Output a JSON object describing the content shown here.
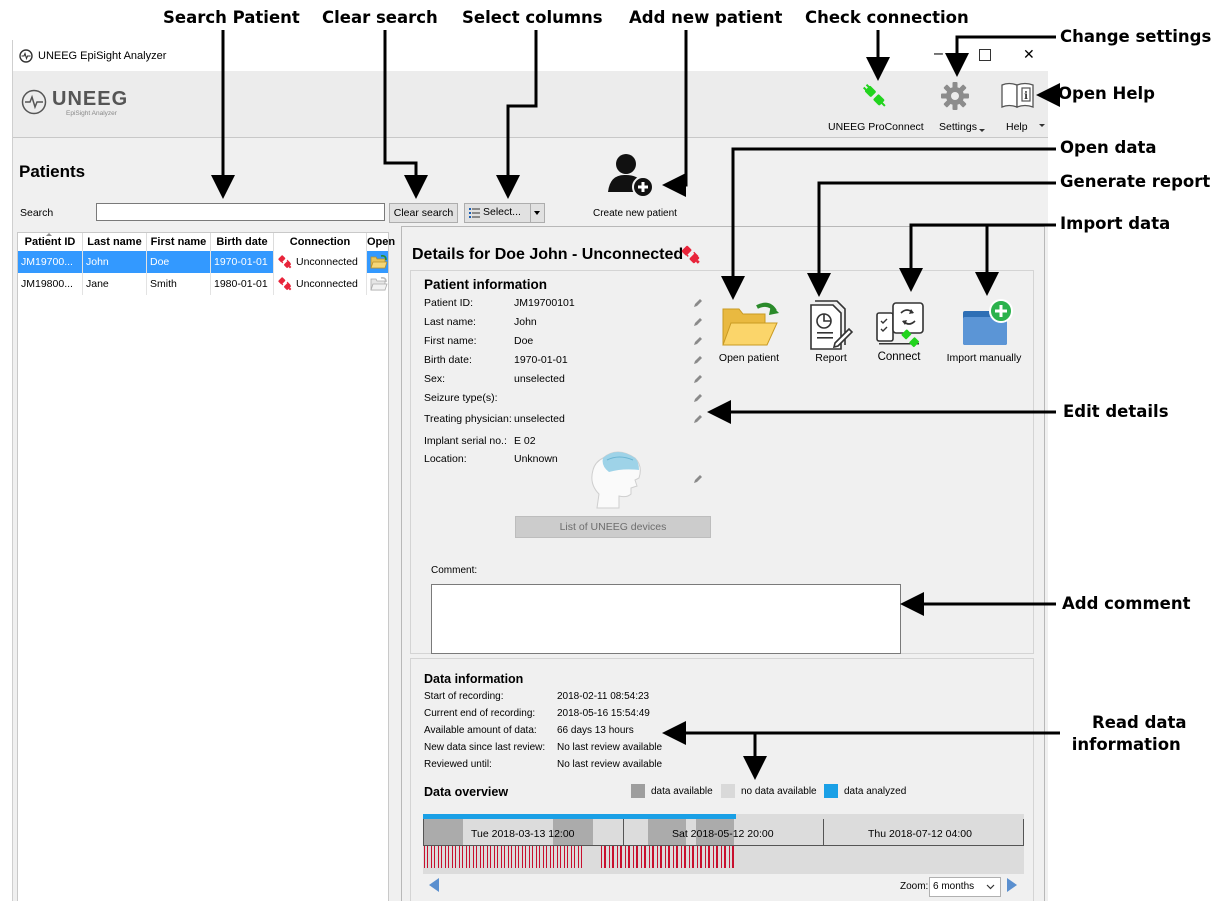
{
  "callouts": {
    "search_patient": "Search Patient",
    "clear_search": "Clear search",
    "select_columns": "Select columns",
    "add_new_patient": "Add new patient",
    "check_connection": "Check connection",
    "change_settings": "Change settings",
    "open_help": "Open Help",
    "open_data": "Open data",
    "generate_report": "Generate report",
    "import_data": "Import data",
    "edit_details": "Edit details",
    "add_comment": "Add comment",
    "read_data_information_1": "Read data",
    "read_data_information_2": "information"
  },
  "window": {
    "title": "UNEEG EpiSight Analyzer",
    "logo_text": "UNEEG",
    "logo_sub": "EpiSight Analyzer",
    "minimize": "–",
    "maximize": "☐",
    "close": "✕"
  },
  "toolbar": {
    "proconnect_label": "UNEEG ProConnect",
    "settings_label": "Settings",
    "help_label": "Help"
  },
  "patients": {
    "title": "Patients",
    "search_label": "Search",
    "search_value": "",
    "clear_search": "Clear search",
    "select_columns": "Select...",
    "create_new_patient": "Create new patient",
    "columns": [
      "Patient ID",
      "Last name",
      "First name",
      "Birth date",
      "Connection",
      "Open"
    ],
    "rows": [
      {
        "id": "JM19700...",
        "last": "John",
        "first": "Doe",
        "birth": "1970-01-01",
        "connection": "Unconnected",
        "selected": true
      },
      {
        "id": "JM19800...",
        "last": "Jane",
        "first": "Smith",
        "birth": "1980-01-01",
        "connection": "Unconnected",
        "selected": false
      }
    ]
  },
  "details": {
    "title": "Details for Doe John - Unconnected",
    "patient_info_title": "Patient information",
    "fields": [
      {
        "label": "Patient ID:",
        "value": "JM19700101"
      },
      {
        "label": "Last name:",
        "value": "John"
      },
      {
        "label": "First name:",
        "value": "Doe"
      },
      {
        "label": "Birth date:",
        "value": "1970-01-01"
      },
      {
        "label": "Sex:",
        "value": "unselected"
      },
      {
        "label": "Seizure type(s):",
        "value": ""
      },
      {
        "label": "Treating physician:",
        "value": "unselected"
      },
      {
        "label": "Implant serial no.:",
        "value": "E 02"
      },
      {
        "label": "Location:",
        "value": "Unknown"
      }
    ],
    "actions": {
      "open_patient": "Open patient",
      "report": "Report",
      "connect": "Connect",
      "import_manually": "Import manually"
    },
    "list_devices": "List of UNEEG devices",
    "comment_label": "Comment:",
    "comment_value": ""
  },
  "data_info": {
    "title": "Data information",
    "fields": [
      {
        "label": "Start of recording:",
        "value": "2018-02-11 08:54:23"
      },
      {
        "label": "Current end of recording:",
        "value": "2018-05-16 15:54:49"
      },
      {
        "label": "Available amount of data:",
        "value": "66 days 13 hours"
      },
      {
        "label": "New data since last review:",
        "value": "No last review available"
      },
      {
        "label": "Reviewed until:",
        "value": "No last review available"
      }
    ],
    "overview_title": "Data overview",
    "legend": {
      "available": "data available",
      "no_data": "no data available",
      "analyzed": "data analyzed"
    },
    "timeline_labels": [
      "Tue 2018-03-13 12:00",
      "Sat 2018-05-12 20:00",
      "Thu 2018-07-12 04:00"
    ],
    "zoom_label": "Zoom:",
    "zoom_value": "6 months"
  },
  "colors": {
    "selection": "#3399ff",
    "connected": "#22d41e",
    "unconnected": "#e8243a",
    "analyzed": "#1aa0e6",
    "available": "#9e9e9e",
    "no_data": "#d9d9d9",
    "event": "#c8102e"
  }
}
